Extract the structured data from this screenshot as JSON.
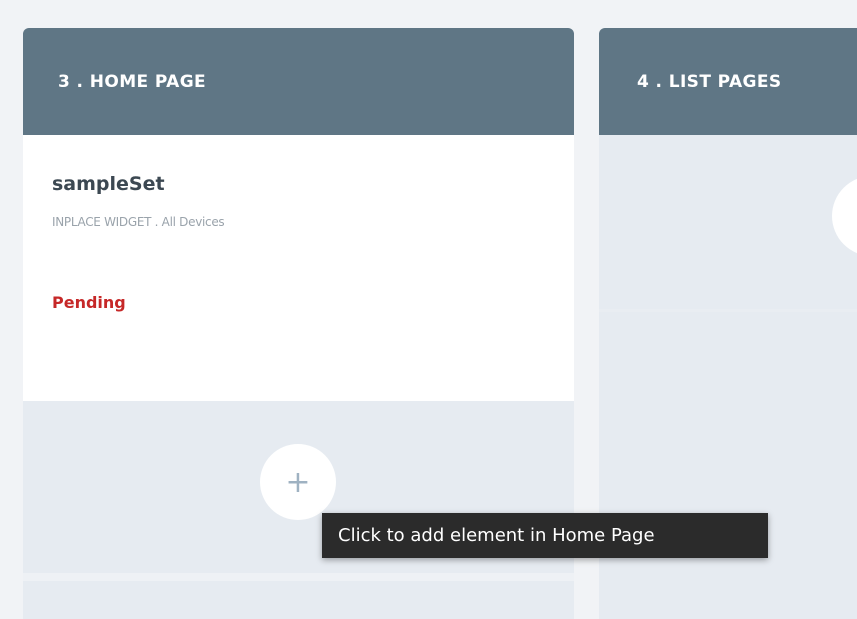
{
  "columns": [
    {
      "title": "3 . HOME PAGE",
      "card": {
        "name": "sampleSet",
        "meta": "INPLACE WIDGET . All Devices",
        "status": "Pending"
      },
      "add_icon": "+"
    },
    {
      "title": "4 . LIST PAGES"
    }
  ],
  "tooltip": "Click to add element in Home Page",
  "colors": {
    "header_bg": "#5f7685",
    "column_bg": "#e6ebf1",
    "status_pending": "#c62828",
    "tooltip_bg": "#2b2b2b"
  },
  "icons": {
    "add": "plus-icon"
  }
}
